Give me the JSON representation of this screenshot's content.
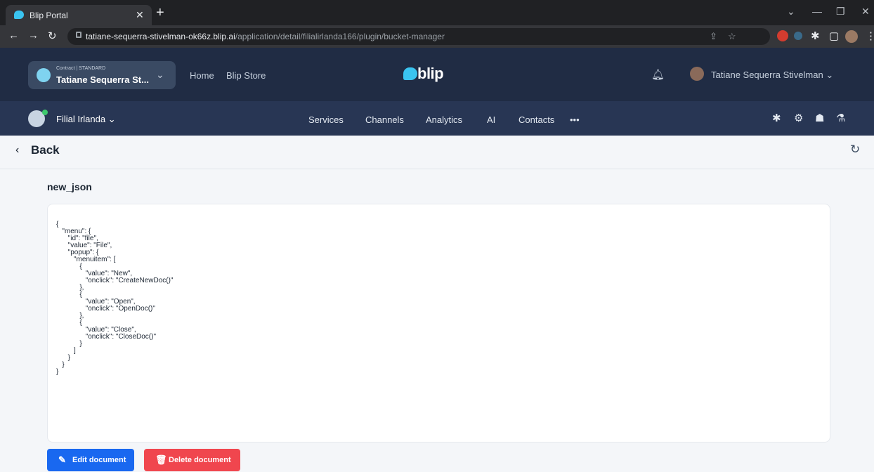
{
  "browser": {
    "tab_title": "Blip Portal",
    "url_host": "tatiane-sequerra-stivelman-ok66z.blip.ai",
    "url_path": "/application/detail/filialirlanda166/plugin/bucket-manager"
  },
  "header": {
    "contract_label": "Contract | STANDARD",
    "contract_name": "Tatiane Sequerra St...",
    "links": [
      "Home",
      "Blip Store"
    ],
    "logo_text": "blip",
    "user_name": "Tatiane Sequerra Stivelman ⌄"
  },
  "subnav": {
    "bot_name": "Filial Irlanda ⌄",
    "items": [
      "Services",
      "Channels",
      "Analytics",
      "AI",
      "Contacts",
      "•••"
    ]
  },
  "page": {
    "back_label": "Back",
    "document_title": "new_json",
    "json_text": "{\n   \"menu\": {\n      \"id\": \"file\",\n      \"value\": \"File\",\n      \"popup\": {\n         \"menuitem\": [\n            {\n               \"value\": \"New\",\n               \"onclick\": \"CreateNewDoc()\"\n            },\n            {\n               \"value\": \"Open\",\n               \"onclick\": \"OpenDoc()\"\n            },\n            {\n               \"value\": \"Close\",\n               \"onclick\": \"CloseDoc()\"\n            }\n         ]\n      }\n   }\n}",
    "edit_button": "Edit document",
    "delete_button": "Delete document"
  },
  "colors": {
    "header_bg": "#202c44",
    "subnav_bg": "#283654",
    "edit_button": "#1968f0",
    "delete_button": "#f0464e",
    "brand": "#3ac4f0"
  },
  "icons": [
    "blip-favicon-icon",
    "lock-icon",
    "bell-icon",
    "puzzle-icon",
    "gear-icon",
    "team-icon",
    "flask-icon",
    "refresh-icon",
    "pencil-icon",
    "trash-icon"
  ]
}
